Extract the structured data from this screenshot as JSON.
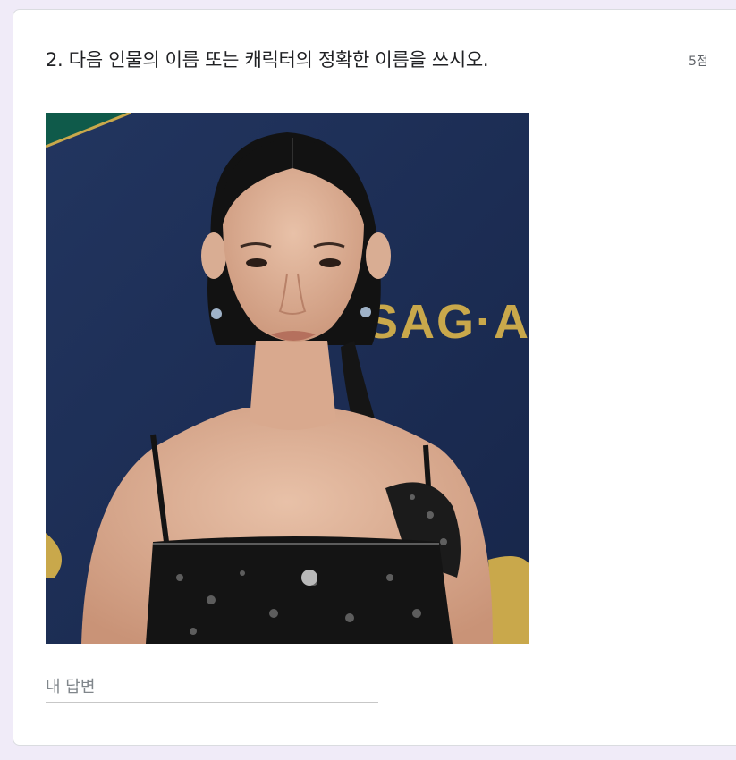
{
  "question": {
    "title": "2. 다음 인물의 이름 또는 캐릭터의 정확한 이름을 쓰시오.",
    "points": "5점"
  },
  "image": {
    "backdrop_text": "SAG·AI",
    "colors": {
      "backdrop": "#1d2f58",
      "gold": "#c9a84b",
      "dress": "#141414"
    }
  },
  "answer": {
    "placeholder": "내 답변",
    "value": ""
  },
  "colors": {
    "page_bg": "#f0ebf8",
    "card_bg": "#ffffff"
  }
}
